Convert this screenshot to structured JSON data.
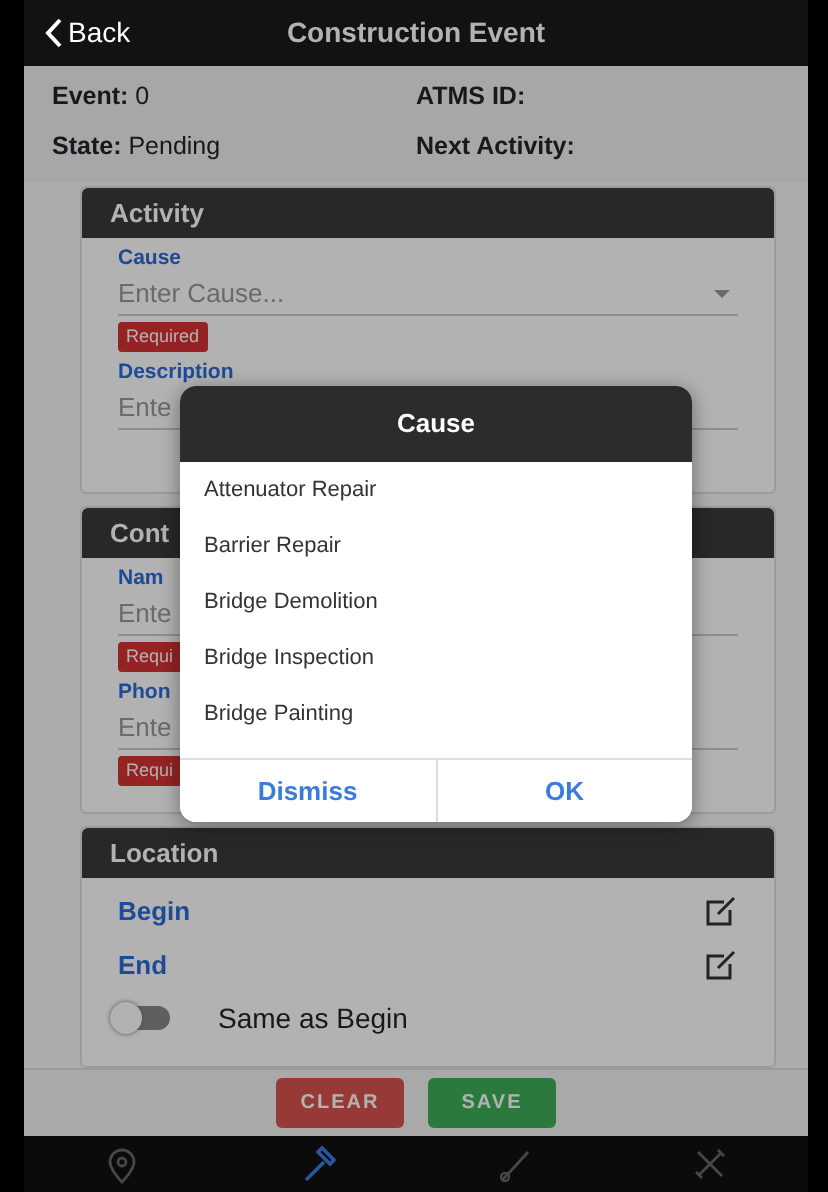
{
  "header": {
    "back": "Back",
    "title": "Construction Event"
  },
  "info": [
    {
      "label": "Event:",
      "value": "0"
    },
    {
      "label": "ATMS ID:"
    },
    {
      "label": "State:",
      "value": "Pending"
    },
    {
      "label": "Next Activity:"
    }
  ],
  "sections": [
    {
      "title": "Activity",
      "fields": [
        {
          "kind": "select",
          "label": "Cause",
          "placeholder": "Enter Cause...",
          "required": "Required"
        },
        {
          "kind": "text",
          "label": "Description",
          "placeholder": "Ente"
        }
      ]
    },
    {
      "title": "Cont",
      "fields": [
        {
          "kind": "text",
          "label": "Nam",
          "placeholder": "Ente",
          "required": "Requi"
        },
        {
          "kind": "text",
          "label": "Phon",
          "placeholder": "Ente",
          "required": "Requi"
        }
      ]
    }
  ],
  "location": {
    "title": "Location",
    "points": [
      {
        "label": "Begin"
      },
      {
        "label": "End"
      }
    ],
    "toggle": {
      "label": "Same as Begin",
      "on": false
    }
  },
  "actions": [
    {
      "label": "CLEAR",
      "kind": "danger"
    },
    {
      "label": "SAVE",
      "kind": "success"
    }
  ],
  "tabs": [
    {
      "kind": "pin",
      "selected": false
    },
    {
      "kind": "hammer",
      "selected": true
    },
    {
      "kind": "brush",
      "selected": false
    },
    {
      "kind": "tools",
      "selected": false
    }
  ],
  "modal": {
    "title": "Cause",
    "options": [
      "Attenuator Repair",
      "Barrier Repair",
      "Bridge Demolition",
      "Bridge Inspection",
      "Bridge Painting"
    ],
    "buttons": [
      "Dismiss",
      "OK"
    ]
  }
}
